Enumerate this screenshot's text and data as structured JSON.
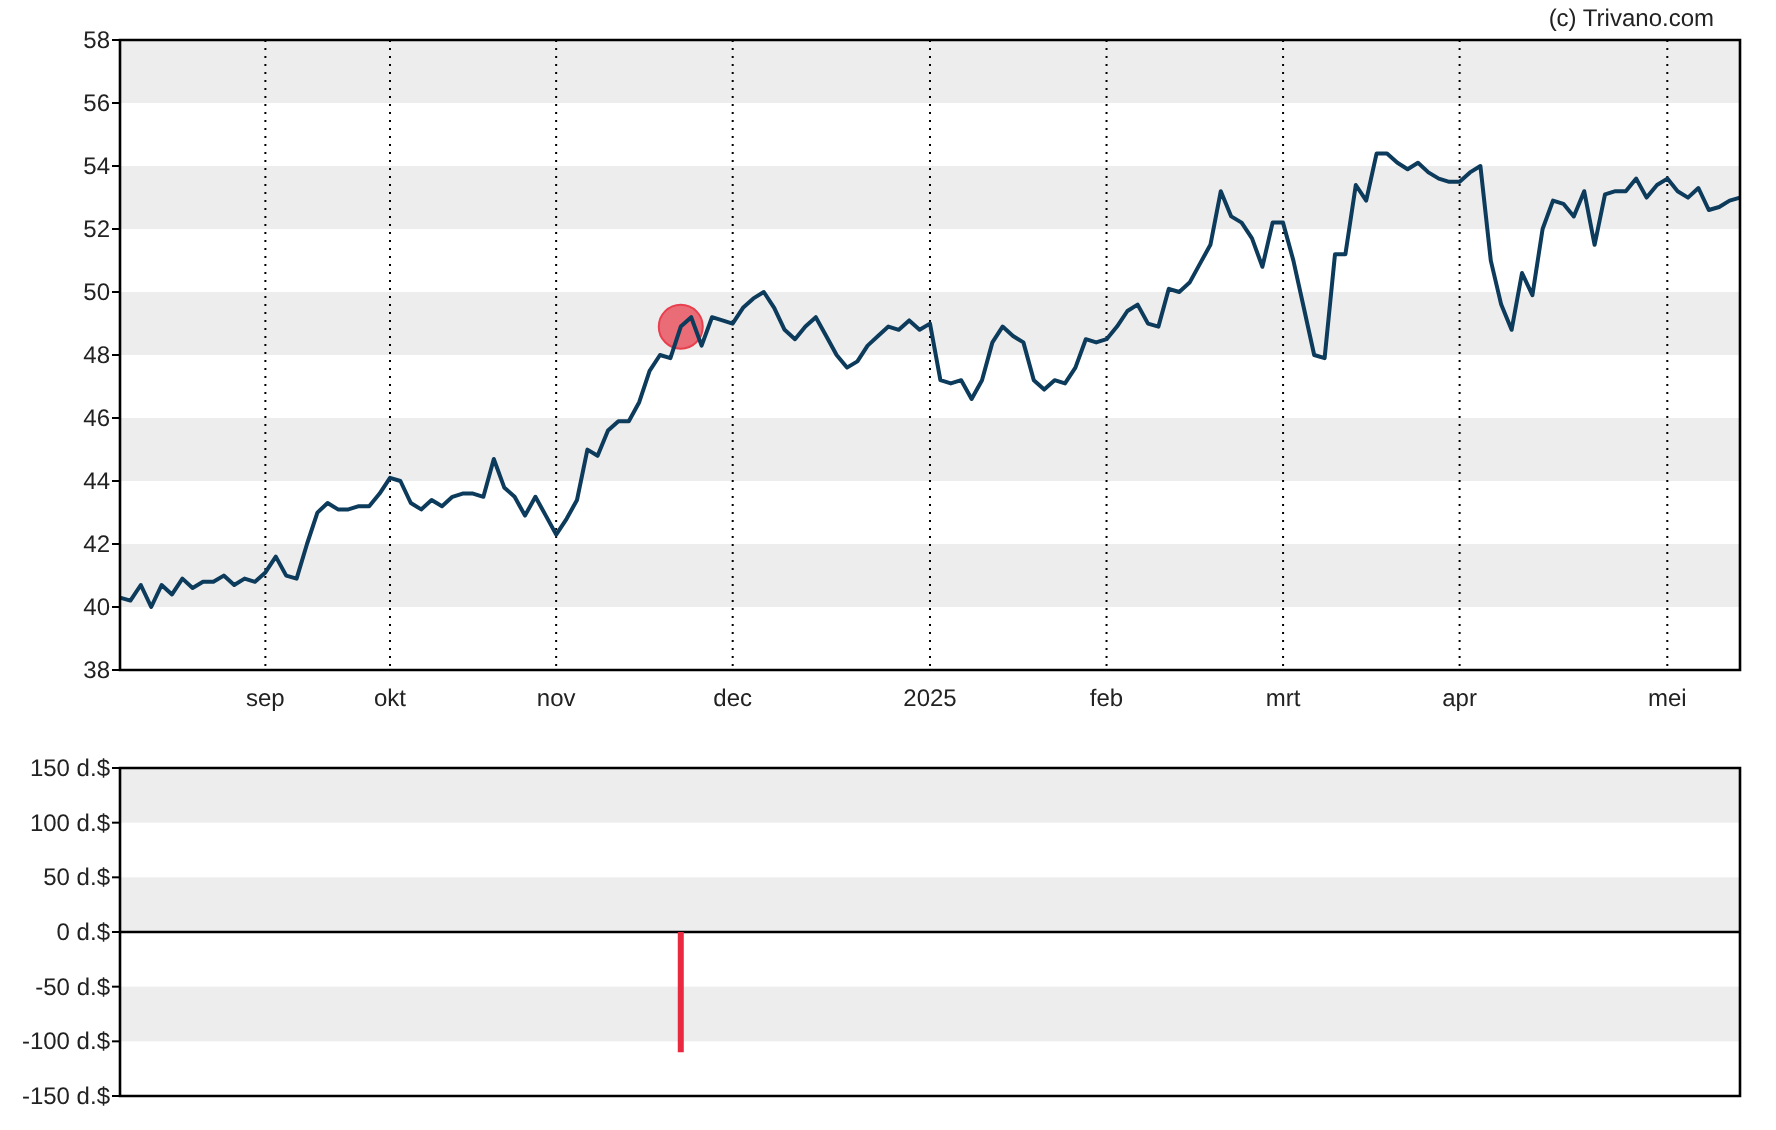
{
  "credit": "(c) Trivano.com",
  "price_chart": {
    "chart_data": {
      "type": "line",
      "ylim": [
        38,
        58
      ],
      "yticks": [
        38,
        40,
        42,
        44,
        46,
        48,
        50,
        52,
        54,
        56,
        58
      ],
      "categories": [
        null,
        null,
        null,
        null,
        null,
        null,
        null,
        null,
        null,
        null,
        null,
        null,
        null,
        null,
        "sep",
        null,
        null,
        null,
        null,
        null,
        null,
        null,
        null,
        null,
        null,
        null,
        "okt",
        null,
        null,
        null,
        null,
        null,
        null,
        null,
        null,
        null,
        null,
        null,
        null,
        null,
        null,
        null,
        "nov",
        null,
        null,
        null,
        null,
        null,
        null,
        null,
        null,
        null,
        null,
        null,
        null,
        null,
        null,
        null,
        null,
        "dec",
        null,
        null,
        null,
        null,
        null,
        null,
        null,
        null,
        null,
        null,
        null,
        null,
        null,
        null,
        null,
        null,
        null,
        null,
        "2025",
        null,
        null,
        null,
        null,
        null,
        null,
        null,
        null,
        null,
        null,
        null,
        null,
        null,
        null,
        null,
        null,
        "feb",
        null,
        null,
        null,
        null,
        null,
        null,
        null,
        null,
        null,
        null,
        null,
        null,
        null,
        null,
        null,
        null,
        "mrt",
        null,
        null,
        null,
        null,
        null,
        null,
        null,
        null,
        null,
        null,
        null,
        null,
        null,
        null,
        null,
        null,
        "apr",
        null,
        null,
        null,
        null,
        null,
        null,
        null,
        null,
        null,
        null,
        null,
        null,
        null,
        null,
        null,
        null,
        null,
        null,
        null,
        "mei",
        null,
        null,
        null,
        null,
        null,
        null,
        null
      ],
      "series": [
        {
          "color": "#0d3b5c",
          "values": [
            40.3,
            40.2,
            40.7,
            40.0,
            40.7,
            40.4,
            40.9,
            40.6,
            40.8,
            40.8,
            41.0,
            40.7,
            40.9,
            40.8,
            41.1,
            41.6,
            41.0,
            40.9,
            42.0,
            43.0,
            43.3,
            43.1,
            43.1,
            43.2,
            43.2,
            43.6,
            44.1,
            44.0,
            43.3,
            43.1,
            43.4,
            43.2,
            43.5,
            43.6,
            43.6,
            43.5,
            44.7,
            43.8,
            43.5,
            42.9,
            43.5,
            42.9,
            42.3,
            42.8,
            43.4,
            45.0,
            44.8,
            45.6,
            45.9,
            45.9,
            46.5,
            47.5,
            48.0,
            47.9,
            48.9,
            49.2,
            48.3,
            49.2,
            49.1,
            49.0,
            49.5,
            49.8,
            50.0,
            49.5,
            48.8,
            48.5,
            48.9,
            49.2,
            48.6,
            48.0,
            47.6,
            47.8,
            48.3,
            48.6,
            48.9,
            48.8,
            49.1,
            48.8,
            49.0,
            47.2,
            47.1,
            47.2,
            46.6,
            47.2,
            48.4,
            48.9,
            48.6,
            48.4,
            47.2,
            46.9,
            47.2,
            47.1,
            47.6,
            48.5,
            48.4,
            48.5,
            48.9,
            49.4,
            49.6,
            49.0,
            48.9,
            50.1,
            50.0,
            50.3,
            50.9,
            51.5,
            53.2,
            52.4,
            52.2,
            51.7,
            50.8,
            52.2,
            52.2,
            51.0,
            49.5,
            48.0,
            47.9,
            51.2,
            51.2,
            53.4,
            52.9,
            54.4,
            54.4,
            54.1,
            53.9,
            54.1,
            53.8,
            53.6,
            53.5,
            53.5,
            53.8,
            54.0,
            51.0,
            49.6,
            48.8,
            50.6,
            49.9,
            52.0,
            52.9,
            52.8,
            52.4,
            53.2,
            51.5,
            53.1,
            53.2,
            53.2,
            53.6,
            53.0,
            53.4,
            53.6,
            53.2,
            53.0,
            53.3,
            52.6,
            52.7,
            52.9,
            53.0
          ]
        }
      ]
    }
  },
  "trade_chart": {
    "chart_data": {
      "type": "bar",
      "ylim": [
        -150,
        150
      ],
      "yticks": [
        {
          "value": 150,
          "label": "150 d.$"
        },
        {
          "value": 100,
          "label": "100 d.$"
        },
        {
          "value": 50,
          "label": "50 d.$"
        },
        {
          "value": 0,
          "label": "0 d.$"
        },
        {
          "value": -50,
          "label": "-50 d.$"
        },
        {
          "value": -100,
          "label": "-100 d.$"
        },
        {
          "value": -150,
          "label": "-150 d.$"
        }
      ],
      "categories": [
        null,
        null,
        null,
        null,
        null,
        null,
        null,
        null,
        null,
        null,
        null,
        null,
        null,
        null,
        null,
        null,
        null,
        null,
        null,
        null,
        null,
        null,
        null,
        null,
        null,
        null,
        null,
        null,
        null,
        null,
        null,
        null,
        null,
        null,
        null,
        null,
        null,
        null,
        null,
        null,
        null,
        null,
        null,
        null,
        null,
        null,
        null,
        null,
        null,
        null,
        null,
        null,
        null,
        null,
        null,
        null,
        null,
        null,
        null,
        null,
        null,
        null,
        null,
        null,
        null,
        null,
        null,
        null,
        null,
        null,
        null,
        null,
        null,
        null,
        null,
        null,
        null,
        null,
        null,
        null,
        null,
        null,
        null,
        null,
        null,
        null,
        null,
        null,
        null,
        null,
        null,
        null,
        null,
        null,
        null,
        null,
        null,
        null,
        null,
        null,
        null,
        null,
        null,
        null,
        null,
        null,
        null,
        null,
        null,
        null,
        null,
        null,
        null,
        null,
        null,
        null,
        null,
        null,
        null,
        null,
        null,
        null,
        null,
        null,
        null,
        null,
        null,
        null,
        null,
        null,
        null,
        null,
        null,
        null,
        null,
        null,
        null,
        null,
        null,
        null,
        null,
        null,
        null,
        null,
        null,
        null,
        null,
        null,
        null,
        null,
        null,
        null,
        null,
        null,
        null,
        null,
        null
      ],
      "series": [
        {
          "color": "#e8293f",
          "values": [
            null,
            null,
            null,
            null,
            null,
            null,
            null,
            null,
            null,
            null,
            null,
            null,
            null,
            null,
            null,
            null,
            null,
            null,
            null,
            null,
            null,
            null,
            null,
            null,
            null,
            null,
            null,
            null,
            null,
            null,
            null,
            null,
            null,
            null,
            null,
            null,
            null,
            null,
            null,
            null,
            null,
            null,
            null,
            null,
            null,
            null,
            null,
            null,
            null,
            null,
            null,
            null,
            null,
            null,
            -110,
            null,
            null,
            null,
            null,
            null,
            null,
            null,
            null,
            null,
            null,
            null,
            null,
            null,
            null,
            null,
            null,
            null,
            null,
            null,
            null,
            null,
            null,
            null,
            null,
            null,
            null,
            null,
            null,
            null,
            null,
            null,
            null,
            null,
            null,
            null,
            null,
            null,
            null,
            null,
            null,
            null,
            null,
            null,
            null,
            null,
            null,
            null,
            null,
            null,
            null,
            null,
            null,
            null,
            null,
            null,
            null,
            null,
            null,
            null,
            null,
            null,
            null,
            null,
            null,
            null,
            null,
            null,
            null,
            null,
            null,
            null,
            null,
            null,
            null,
            null,
            null,
            null,
            null,
            null,
            null,
            null,
            null,
            null,
            null,
            null,
            null,
            null,
            null,
            null,
            null,
            null,
            null,
            null,
            null,
            null,
            null,
            null,
            null,
            null,
            null,
            null,
            null
          ]
        }
      ]
    }
  }
}
